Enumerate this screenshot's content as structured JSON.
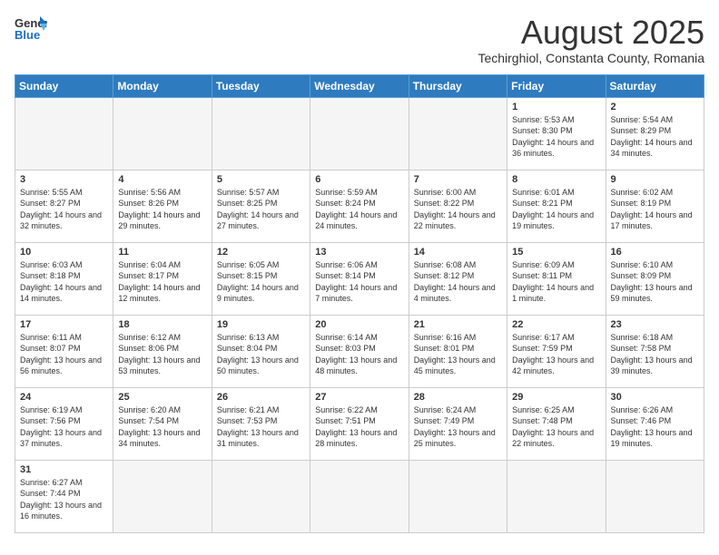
{
  "header": {
    "logo_general": "General",
    "logo_blue": "Blue",
    "title": "August 2025",
    "subtitle": "Techirghiol, Constanta County, Romania"
  },
  "days_of_week": [
    "Sunday",
    "Monday",
    "Tuesday",
    "Wednesday",
    "Thursday",
    "Friday",
    "Saturday"
  ],
  "weeks": [
    [
      {
        "day": "",
        "info": ""
      },
      {
        "day": "",
        "info": ""
      },
      {
        "day": "",
        "info": ""
      },
      {
        "day": "",
        "info": ""
      },
      {
        "day": "",
        "info": ""
      },
      {
        "day": "1",
        "info": "Sunrise: 5:53 AM\nSunset: 8:30 PM\nDaylight: 14 hours and 36 minutes."
      },
      {
        "day": "2",
        "info": "Sunrise: 5:54 AM\nSunset: 8:29 PM\nDaylight: 14 hours and 34 minutes."
      }
    ],
    [
      {
        "day": "3",
        "info": "Sunrise: 5:55 AM\nSunset: 8:27 PM\nDaylight: 14 hours and 32 minutes."
      },
      {
        "day": "4",
        "info": "Sunrise: 5:56 AM\nSunset: 8:26 PM\nDaylight: 14 hours and 29 minutes."
      },
      {
        "day": "5",
        "info": "Sunrise: 5:57 AM\nSunset: 8:25 PM\nDaylight: 14 hours and 27 minutes."
      },
      {
        "day": "6",
        "info": "Sunrise: 5:59 AM\nSunset: 8:24 PM\nDaylight: 14 hours and 24 minutes."
      },
      {
        "day": "7",
        "info": "Sunrise: 6:00 AM\nSunset: 8:22 PM\nDaylight: 14 hours and 22 minutes."
      },
      {
        "day": "8",
        "info": "Sunrise: 6:01 AM\nSunset: 8:21 PM\nDaylight: 14 hours and 19 minutes."
      },
      {
        "day": "9",
        "info": "Sunrise: 6:02 AM\nSunset: 8:19 PM\nDaylight: 14 hours and 17 minutes."
      }
    ],
    [
      {
        "day": "10",
        "info": "Sunrise: 6:03 AM\nSunset: 8:18 PM\nDaylight: 14 hours and 14 minutes."
      },
      {
        "day": "11",
        "info": "Sunrise: 6:04 AM\nSunset: 8:17 PM\nDaylight: 14 hours and 12 minutes."
      },
      {
        "day": "12",
        "info": "Sunrise: 6:05 AM\nSunset: 8:15 PM\nDaylight: 14 hours and 9 minutes."
      },
      {
        "day": "13",
        "info": "Sunrise: 6:06 AM\nSunset: 8:14 PM\nDaylight: 14 hours and 7 minutes."
      },
      {
        "day": "14",
        "info": "Sunrise: 6:08 AM\nSunset: 8:12 PM\nDaylight: 14 hours and 4 minutes."
      },
      {
        "day": "15",
        "info": "Sunrise: 6:09 AM\nSunset: 8:11 PM\nDaylight: 14 hours and 1 minute."
      },
      {
        "day": "16",
        "info": "Sunrise: 6:10 AM\nSunset: 8:09 PM\nDaylight: 13 hours and 59 minutes."
      }
    ],
    [
      {
        "day": "17",
        "info": "Sunrise: 6:11 AM\nSunset: 8:07 PM\nDaylight: 13 hours and 56 minutes."
      },
      {
        "day": "18",
        "info": "Sunrise: 6:12 AM\nSunset: 8:06 PM\nDaylight: 13 hours and 53 minutes."
      },
      {
        "day": "19",
        "info": "Sunrise: 6:13 AM\nSunset: 8:04 PM\nDaylight: 13 hours and 50 minutes."
      },
      {
        "day": "20",
        "info": "Sunrise: 6:14 AM\nSunset: 8:03 PM\nDaylight: 13 hours and 48 minutes."
      },
      {
        "day": "21",
        "info": "Sunrise: 6:16 AM\nSunset: 8:01 PM\nDaylight: 13 hours and 45 minutes."
      },
      {
        "day": "22",
        "info": "Sunrise: 6:17 AM\nSunset: 7:59 PM\nDaylight: 13 hours and 42 minutes."
      },
      {
        "day": "23",
        "info": "Sunrise: 6:18 AM\nSunset: 7:58 PM\nDaylight: 13 hours and 39 minutes."
      }
    ],
    [
      {
        "day": "24",
        "info": "Sunrise: 6:19 AM\nSunset: 7:56 PM\nDaylight: 13 hours and 37 minutes."
      },
      {
        "day": "25",
        "info": "Sunrise: 6:20 AM\nSunset: 7:54 PM\nDaylight: 13 hours and 34 minutes."
      },
      {
        "day": "26",
        "info": "Sunrise: 6:21 AM\nSunset: 7:53 PM\nDaylight: 13 hours and 31 minutes."
      },
      {
        "day": "27",
        "info": "Sunrise: 6:22 AM\nSunset: 7:51 PM\nDaylight: 13 hours and 28 minutes."
      },
      {
        "day": "28",
        "info": "Sunrise: 6:24 AM\nSunset: 7:49 PM\nDaylight: 13 hours and 25 minutes."
      },
      {
        "day": "29",
        "info": "Sunrise: 6:25 AM\nSunset: 7:48 PM\nDaylight: 13 hours and 22 minutes."
      },
      {
        "day": "30",
        "info": "Sunrise: 6:26 AM\nSunset: 7:46 PM\nDaylight: 13 hours and 19 minutes."
      }
    ],
    [
      {
        "day": "31",
        "info": "Sunrise: 6:27 AM\nSunset: 7:44 PM\nDaylight: 13 hours and 16 minutes."
      },
      {
        "day": "",
        "info": ""
      },
      {
        "day": "",
        "info": ""
      },
      {
        "day": "",
        "info": ""
      },
      {
        "day": "",
        "info": ""
      },
      {
        "day": "",
        "info": ""
      },
      {
        "day": "",
        "info": ""
      }
    ]
  ]
}
